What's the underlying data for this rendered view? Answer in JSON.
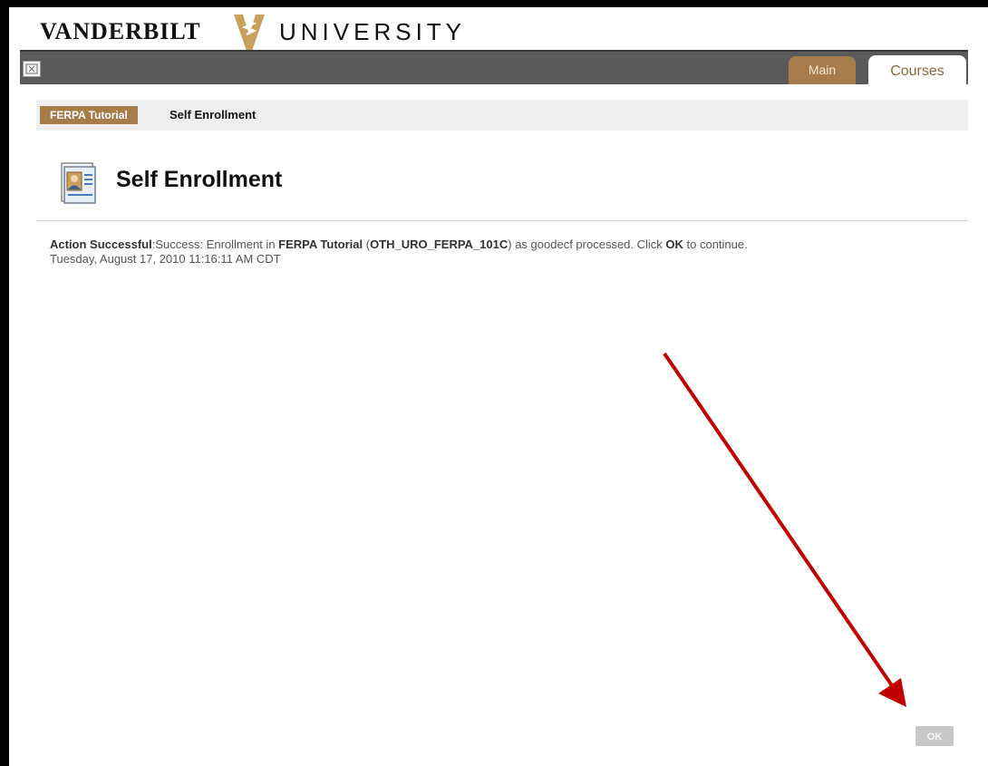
{
  "header": {
    "logo_left": "VANDERBILT",
    "logo_right": "UNIVERSITY",
    "brand_color": "#a67c4a"
  },
  "nav": {
    "toggle_icon": "menu-toggle-icon",
    "tabs": [
      {
        "label": "Main",
        "active": false
      },
      {
        "label": "Courses",
        "active": true
      }
    ]
  },
  "breadcrumb": {
    "items": [
      "FERPA Tutorial",
      "Self Enrollment"
    ]
  },
  "page": {
    "title": "Self Enrollment",
    "icon": "enrollment-id-card-icon"
  },
  "receipt": {
    "status": "Action Successful",
    "message_prefix": "Success: Enrollment in ",
    "course_name": "FERPA Tutorial",
    "course_code_open": " (",
    "course_code": "OTH_URO_FERPA_101C",
    "message_middle": ") as goodecf processed. Click ",
    "ok_word": "OK",
    "message_suffix": " to continue.",
    "timestamp": "Tuesday, August 17, 2010 11:16:11 AM CDT"
  },
  "annotation": {
    "arrow_color": "#c00000"
  },
  "ok_button": {
    "label": "OK"
  }
}
